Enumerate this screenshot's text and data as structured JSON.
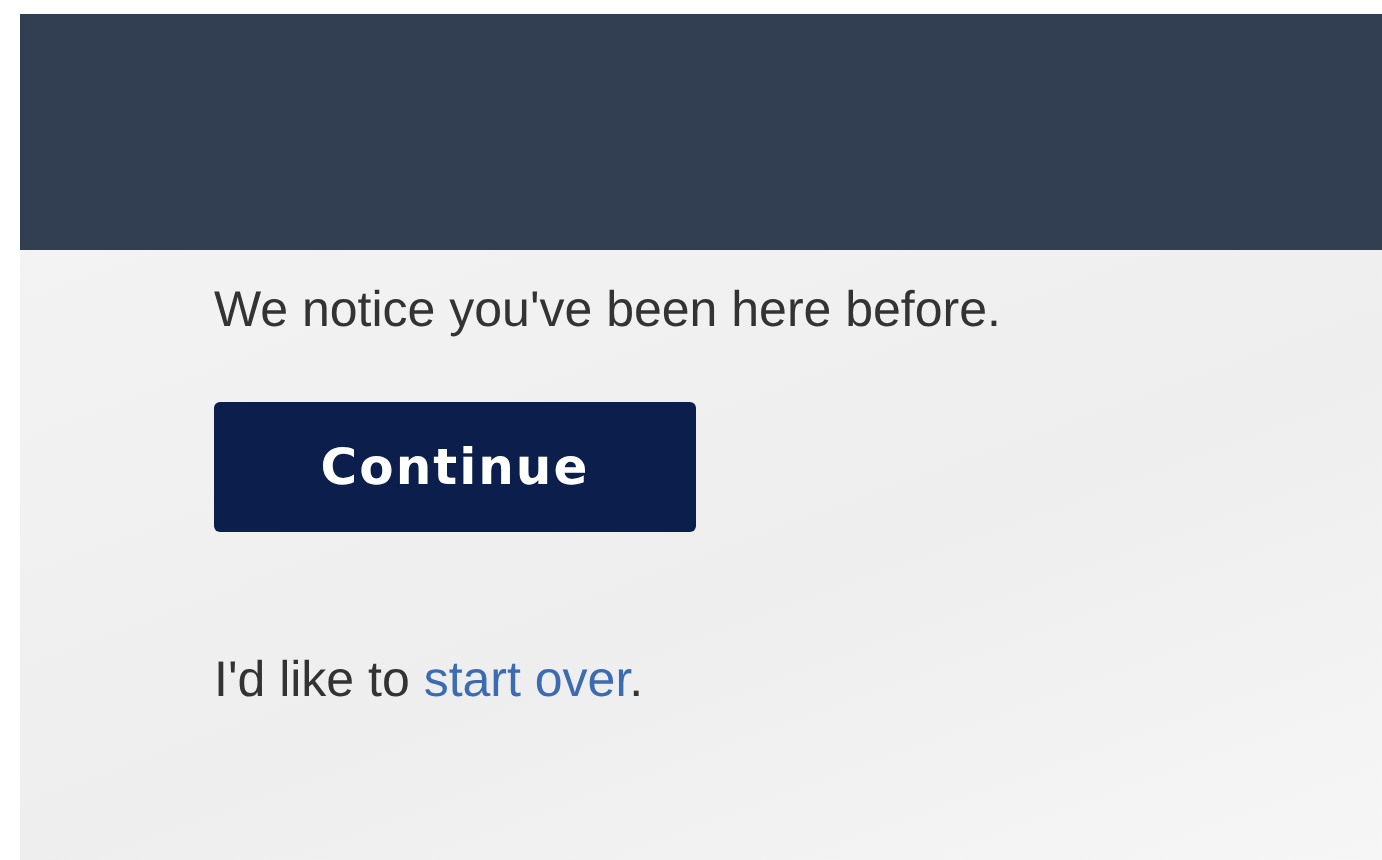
{
  "message": "We notice you've been here before.",
  "continue_button": {
    "label": "Continue"
  },
  "start_over": {
    "prefix": "I'd like to ",
    "link": "start over",
    "suffix": "."
  }
}
